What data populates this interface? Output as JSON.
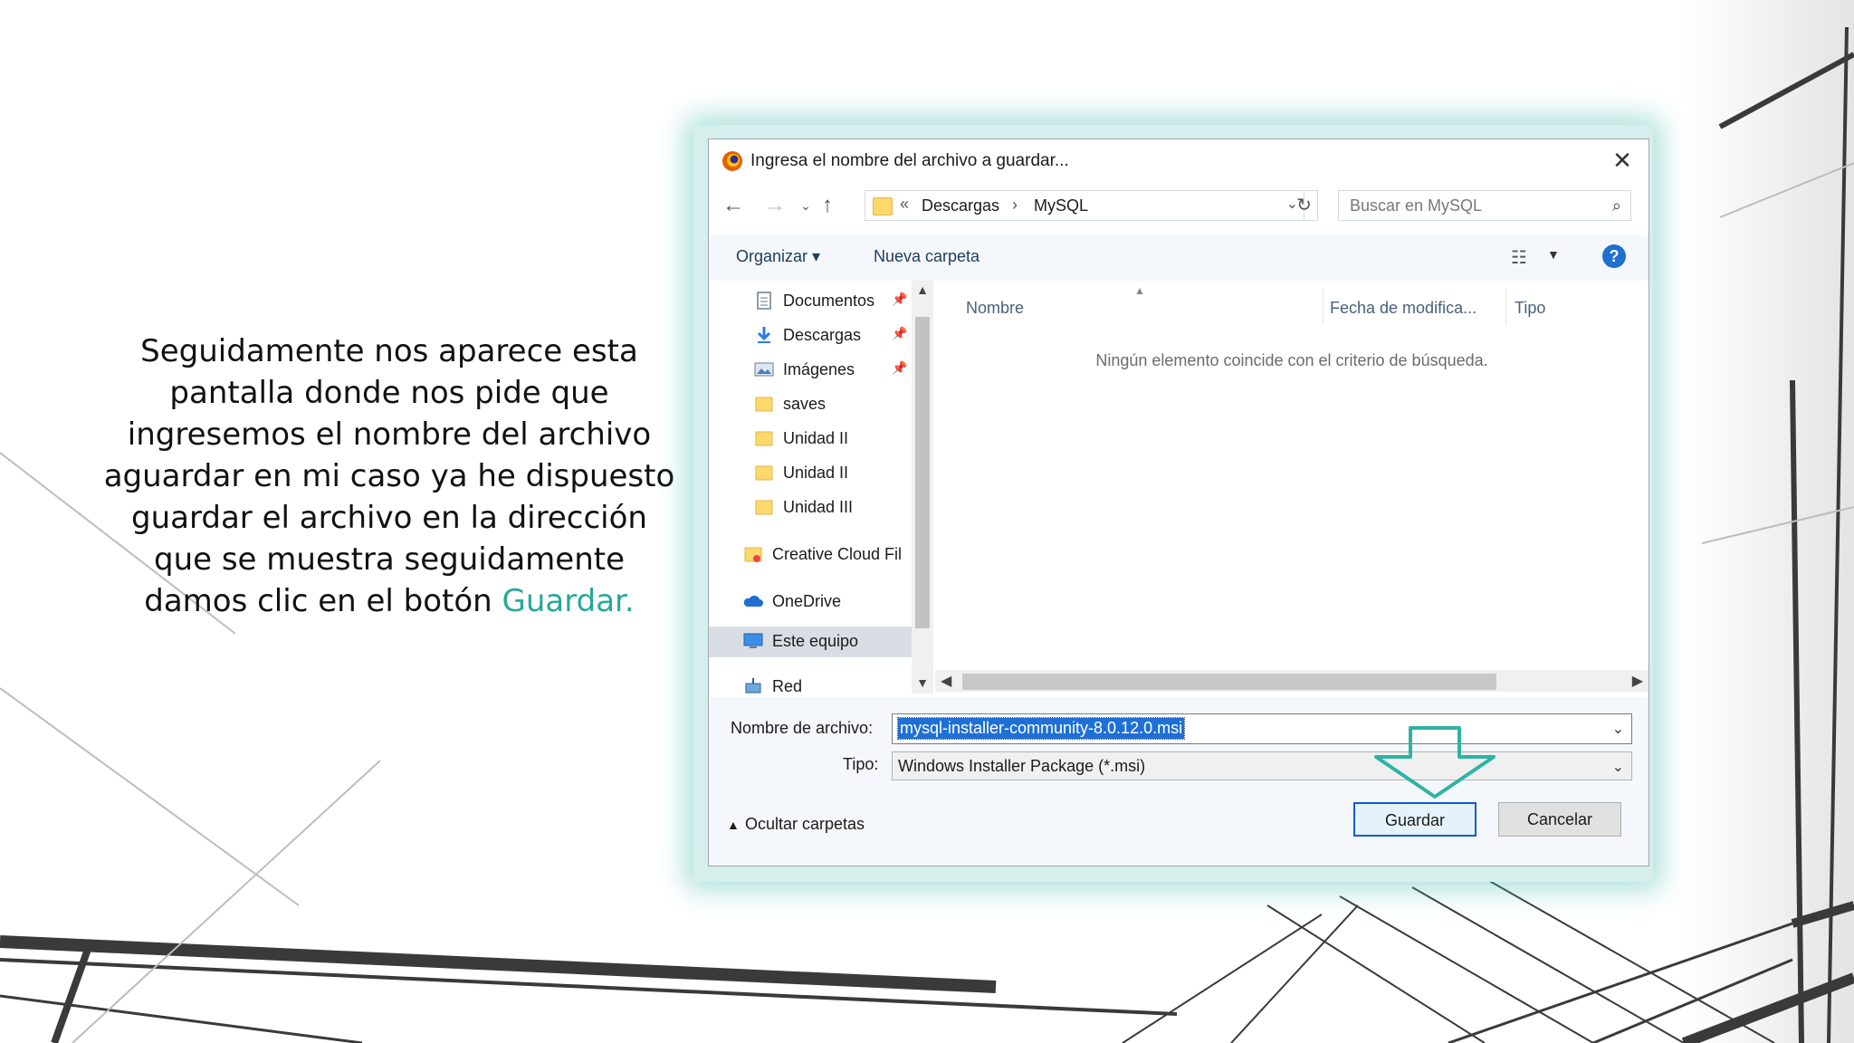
{
  "caption": {
    "text": "Seguidamente nos aparece esta pantalla donde nos pide que ingresemos el nombre del archivo aguardar en mi caso ya he dispuesto guardar el archivo en la dirección que se muestra seguidamente damos clic en el botón ",
    "highlight": "Guardar.",
    "highlight_color": "#27a89a"
  },
  "dialog": {
    "title": "Ingresa el nombre del archivo a guardar...",
    "close_glyph": "✕",
    "address": {
      "prefix": "«",
      "crumbs": [
        "Descargas",
        "MySQL"
      ],
      "separator": "›"
    },
    "search_placeholder": "Buscar en MySQL",
    "toolbar": {
      "organize": "Organizar ▾",
      "new_folder": "Nueva carpeta",
      "help": "?"
    },
    "nav_items": [
      {
        "label": "Documentos",
        "pinned": true
      },
      {
        "label": "Descargas",
        "pinned": true
      },
      {
        "label": "Imágenes",
        "pinned": true
      },
      {
        "label": "saves",
        "pinned": false
      },
      {
        "label": "Unidad II",
        "pinned": false
      },
      {
        "label": "Unidad II",
        "pinned": false
      },
      {
        "label": "Unidad III",
        "pinned": false
      },
      {
        "label": "Creative Cloud Fil",
        "pinned": false
      },
      {
        "label": "OneDrive",
        "pinned": false
      },
      {
        "label": "Este equipo",
        "pinned": false,
        "selected": true
      },
      {
        "label": "Red",
        "pinned": false
      }
    ],
    "columns": [
      "Nombre",
      "Fecha de modifica...",
      "Tipo"
    ],
    "empty_message": "Ningún elemento coincide con el criterio de búsqueda.",
    "filename_label": "Nombre de archivo:",
    "filename_value": "mysql-installer-community-8.0.12.0.msi",
    "type_label": "Tipo:",
    "type_value": "Windows Installer Package (*.msi)",
    "hide_folders": "Ocultar carpetas",
    "save_button": "Guardar",
    "cancel_button": "Cancelar",
    "colors": {
      "accent": "#27a89a",
      "selection": "#1e70d7",
      "help": "#1f6fd1"
    }
  }
}
